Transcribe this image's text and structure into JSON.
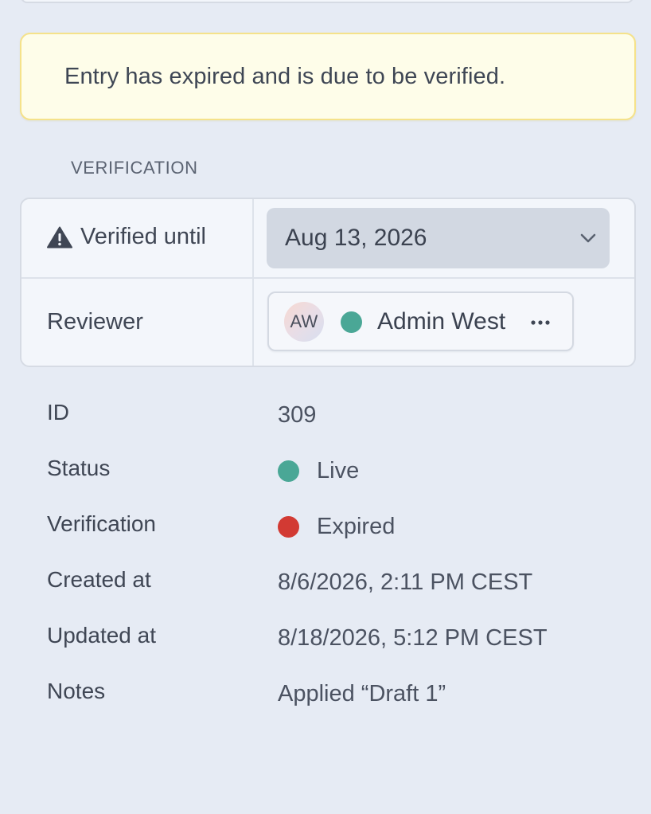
{
  "alert": {
    "message": "Entry has expired and is due to be verified.",
    "color": "#fefde9",
    "border_color": "#f5e28a"
  },
  "verification_section": {
    "heading": "VERIFICATION",
    "verified_until": {
      "label": "Verified until",
      "icon": "warning-triangle-icon",
      "value": "Aug 13, 2026",
      "dropdown_icon": "chevron-down-icon"
    },
    "reviewer": {
      "label": "Reviewer",
      "avatar_initials": "AW",
      "name": "Admin West",
      "presence_color": "#4aa796",
      "more_icon": "ellipsis-icon"
    }
  },
  "details": {
    "id": {
      "label": "ID",
      "value": "309"
    },
    "status": {
      "label": "Status",
      "value": "Live",
      "color": "#4aa796"
    },
    "verification": {
      "label": "Verification",
      "value": "Expired",
      "color": "#d23a33"
    },
    "created_at": {
      "label": "Created at",
      "value": "8/6/2026, 2:11 PM CEST"
    },
    "updated_at": {
      "label": "Updated at",
      "value": "8/18/2026, 5:12 PM CEST"
    },
    "notes": {
      "label": "Notes",
      "value": "Applied “Draft 1”"
    }
  }
}
